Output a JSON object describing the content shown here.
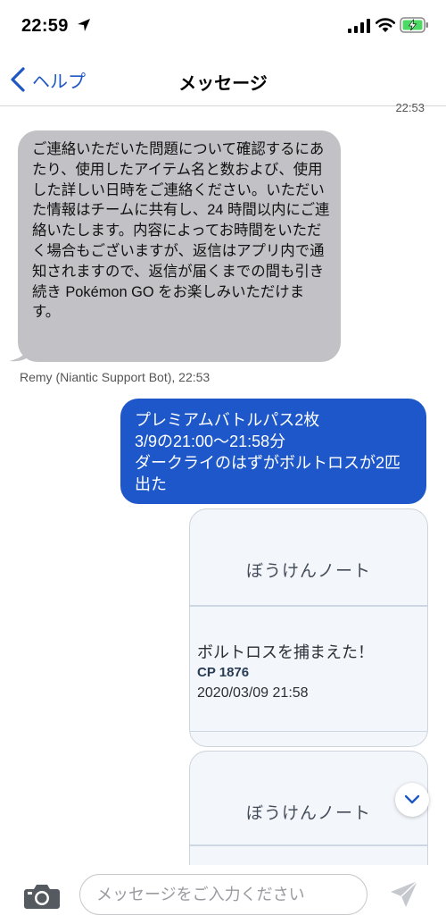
{
  "status_bar": {
    "time": "22:59",
    "icons": [
      "location-arrow-icon",
      "cellular-signal-icon",
      "wifi-icon",
      "battery-charging-icon"
    ]
  },
  "nav": {
    "back_label": "ヘルプ",
    "title": "メッセージ"
  },
  "conversation": {
    "top_timestamp": "22:53",
    "incoming": {
      "text": "ご連絡いただいた問題について確認するにあたり、使用したアイテム名と数および、使用した詳しい日時をご連絡ください。いただいた情報はチームに共有し、24 時間以内にご連絡いたします。内容によってお時間をいただく場合もございますが、返信はアプリ内で通知されますので、返信が届くまでの間も引き続き Pokémon GO をお楽しみいただけます。",
      "caption": "Remy (Niantic Support Bot), 22:53"
    },
    "outgoing": {
      "lines": [
        "プレミアムバトルパス2枚",
        "3/9の21:00〜21:58分",
        "ダークライのはずがボルトロスが2匹出た"
      ]
    },
    "attachments": [
      {
        "title": "ぼうけんノート",
        "caught": "ボルトロスを捕まえた！",
        "cp": "CP 1876",
        "date": "2020/03/09 21:58"
      },
      {
        "title": "ぼうけんノート"
      }
    ]
  },
  "composer": {
    "placeholder": "メッセージをご入力ください",
    "value": ""
  },
  "colors": {
    "accent": "#1d57c9",
    "incoming_bubble": "#c1c1c6",
    "nav_link": "#1f58c4"
  }
}
